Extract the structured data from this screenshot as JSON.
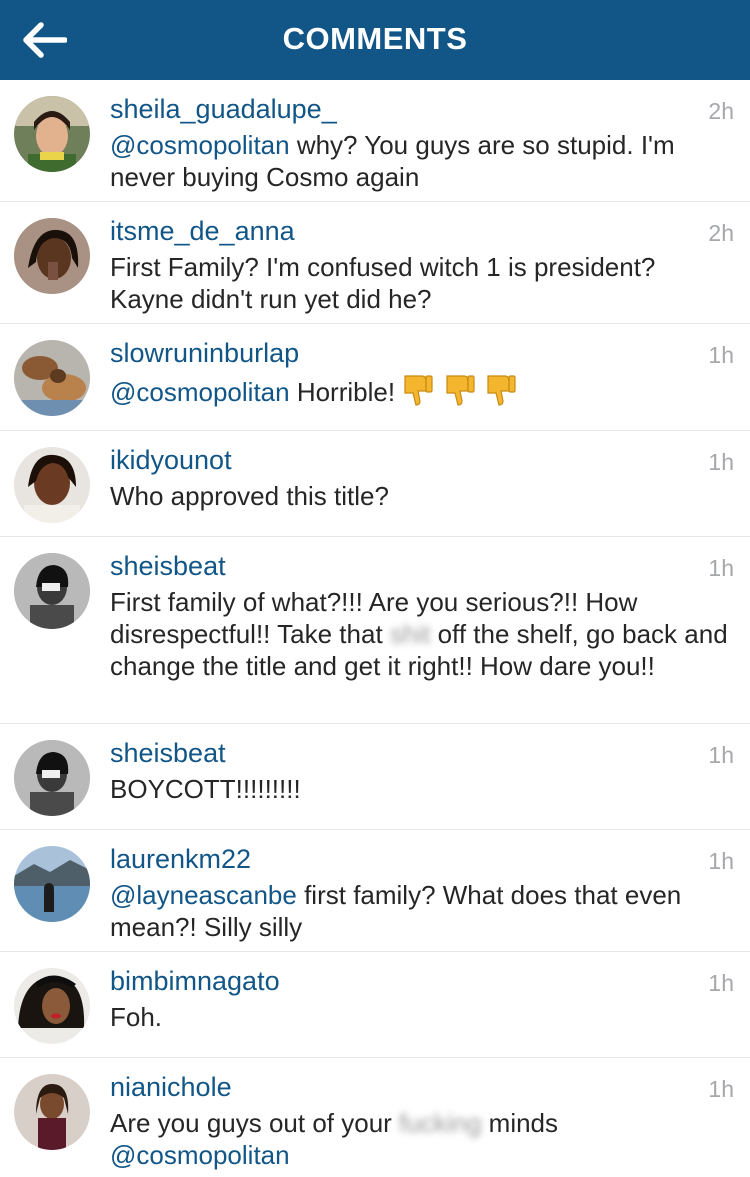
{
  "header": {
    "title": "COMMENTS",
    "back_icon": "arrow-left-icon",
    "bg_color": "#125688"
  },
  "comments": [
    {
      "username": "sheila_guadalupe_",
      "time": "2h",
      "mention": "@cosmopolitan",
      "text": " why? You guys are so stupid. I'm never buying Cosmo again"
    },
    {
      "username": "itsme_de_anna",
      "time": "2h",
      "text": "First Family? I'm confused witch 1 is  president? Kayne didn't run yet did he?"
    },
    {
      "username": "slowruninburlap",
      "time": "1h",
      "mention": "@cosmopolitan",
      "text": " Horrible! ",
      "emoji": "thumbs-down-icon"
    },
    {
      "username": "ikidyounot",
      "time": "1h",
      "text": "Who approved this title?"
    },
    {
      "username": "sheisbeat",
      "time": "1h",
      "text_before": "First family of what?!!! Are you serious?!! How disrespectful!! Take that ",
      "blurred": "shit",
      "text_after": " off the shelf, go back and change the title and get it right!! How dare you!!"
    },
    {
      "username": "sheisbeat",
      "time": "1h",
      "text": "BOYCOTT!!!!!!!!!"
    },
    {
      "username": "laurenkm22",
      "time": "1h",
      "mention": "@layneascanbe",
      "text": " first family? What does that even mean?! Silly silly"
    },
    {
      "username": "bimbimnagato",
      "time": "1h",
      "text": "Foh."
    },
    {
      "username": "nianichole",
      "time": "1h",
      "text_before": "Are you guys out of your ",
      "blurred": "fucking",
      "text_after": " minds ",
      "mention_after": "@cosmopolitan"
    }
  ]
}
